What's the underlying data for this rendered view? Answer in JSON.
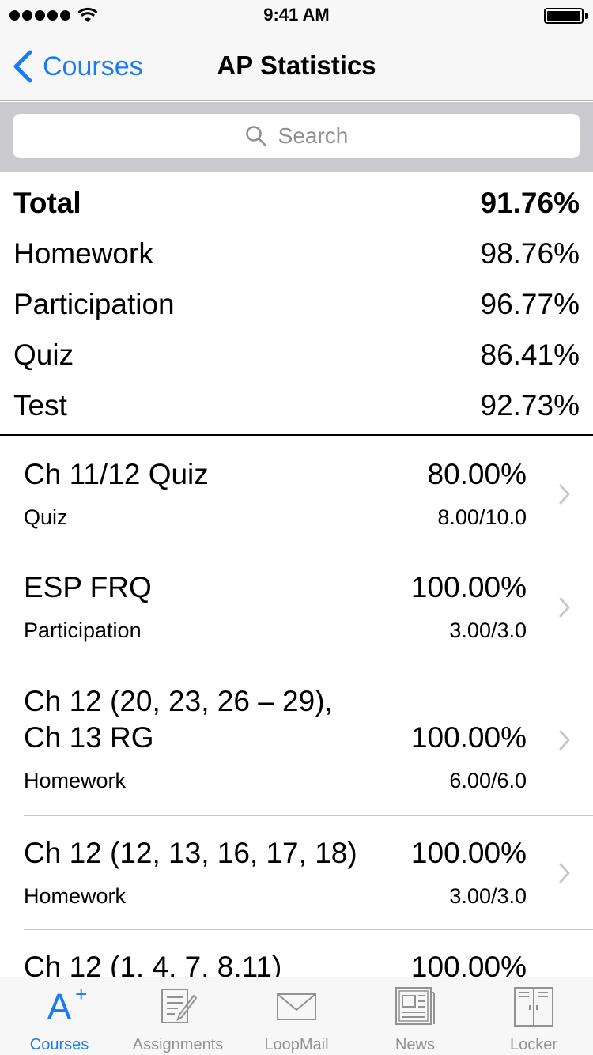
{
  "status_bar": {
    "time": "9:41 AM"
  },
  "nav": {
    "back_label": "Courses",
    "title": "AP Statistics"
  },
  "search": {
    "placeholder": "Search"
  },
  "summary": [
    {
      "label": "Total",
      "value": "91.76%"
    },
    {
      "label": "Homework",
      "value": "98.76%"
    },
    {
      "label": "Participation",
      "value": "96.77%"
    },
    {
      "label": "Quiz",
      "value": "86.41%"
    },
    {
      "label": "Test",
      "value": "92.73%"
    }
  ],
  "assignments": [
    {
      "title": "Ch 11/12 Quiz",
      "score": "80.00%",
      "category": "Quiz",
      "points": "8.00/10.0"
    },
    {
      "title": "ESP FRQ",
      "score": "100.00%",
      "category": "Participation",
      "points": "3.00/3.0"
    },
    {
      "title": "Ch 12 (20, 23, 26 – 29),\nCh 13 RG",
      "score": "100.00%",
      "category": "Homework",
      "points": "6.00/6.0"
    },
    {
      "title": "Ch 12 (12, 13, 16, 17, 18)",
      "score": "100.00%",
      "category": "Homework",
      "points": "3.00/3.0"
    },
    {
      "title": "Ch 12 (1, 4, 7, 8,11)",
      "score": "100.00%",
      "category": "",
      "points": ""
    }
  ],
  "tabs": [
    {
      "label": "Courses",
      "icon": "a-plus-icon",
      "glyph": "A",
      "glyph_sup": "+"
    },
    {
      "label": "Assignments",
      "icon": "assignments-icon"
    },
    {
      "label": "LoopMail",
      "icon": "mail-icon"
    },
    {
      "label": "News",
      "icon": "newspaper-icon"
    },
    {
      "label": "Locker",
      "icon": "locker-icon"
    }
  ],
  "colors": {
    "accent": "#1a7cf5",
    "inactive": "#929292",
    "bar_bg": "#f7f7f7",
    "search_bg": "#c9c9ce"
  }
}
